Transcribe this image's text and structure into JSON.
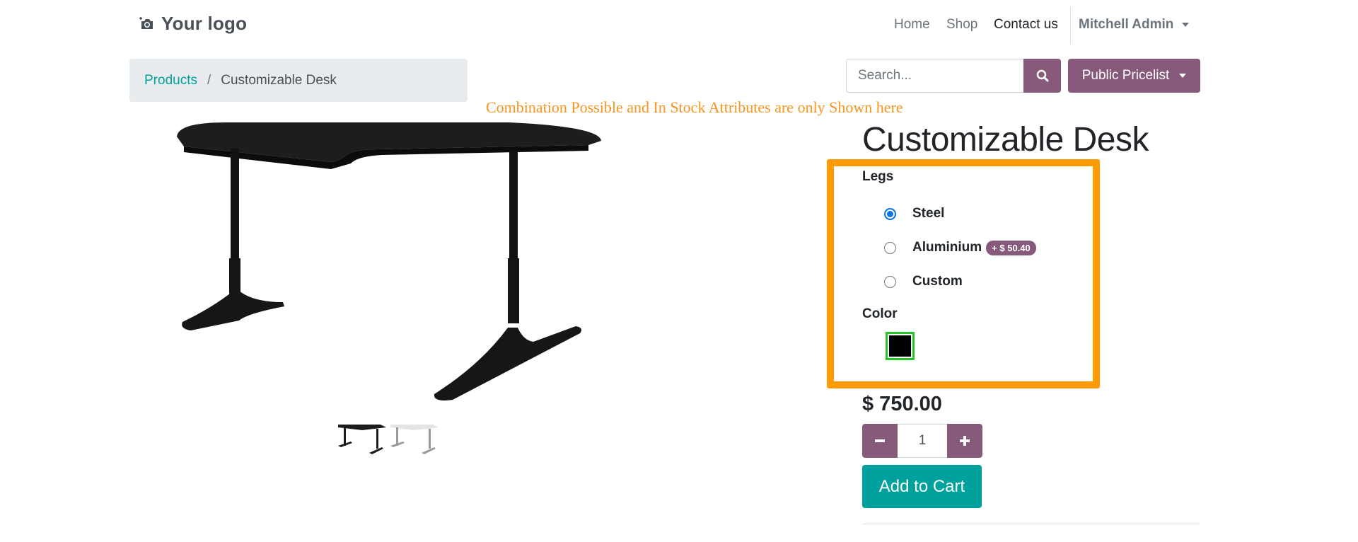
{
  "header": {
    "logo_text": "Your logo",
    "nav": {
      "home": "Home",
      "shop": "Shop",
      "contact": "Contact us",
      "user": "Mitchell Admin"
    }
  },
  "breadcrumb": {
    "parent": "Products",
    "separator": "/",
    "current": "Customizable Desk"
  },
  "search": {
    "placeholder": "Search..."
  },
  "pricelist": {
    "label": "Public Pricelist"
  },
  "annotation": "Combination Possible and In Stock Attributes are only Shown here",
  "product": {
    "title": "Customizable Desk",
    "attributes": {
      "legs_label": "Legs",
      "legs_options": [
        {
          "label": "Steel",
          "selected": true
        },
        {
          "label": "Aluminium",
          "selected": false,
          "extra_price": "+ $ 50.40"
        },
        {
          "label": "Custom",
          "selected": false
        }
      ],
      "color_label": "Color",
      "color_value": "#000000"
    },
    "price": "$ 750.00",
    "quantity": "1",
    "add_to_cart": "Add to Cart"
  },
  "colors": {
    "accent": "#875a7b",
    "primary": "#00a09d",
    "highlight": "#ff9a00"
  }
}
